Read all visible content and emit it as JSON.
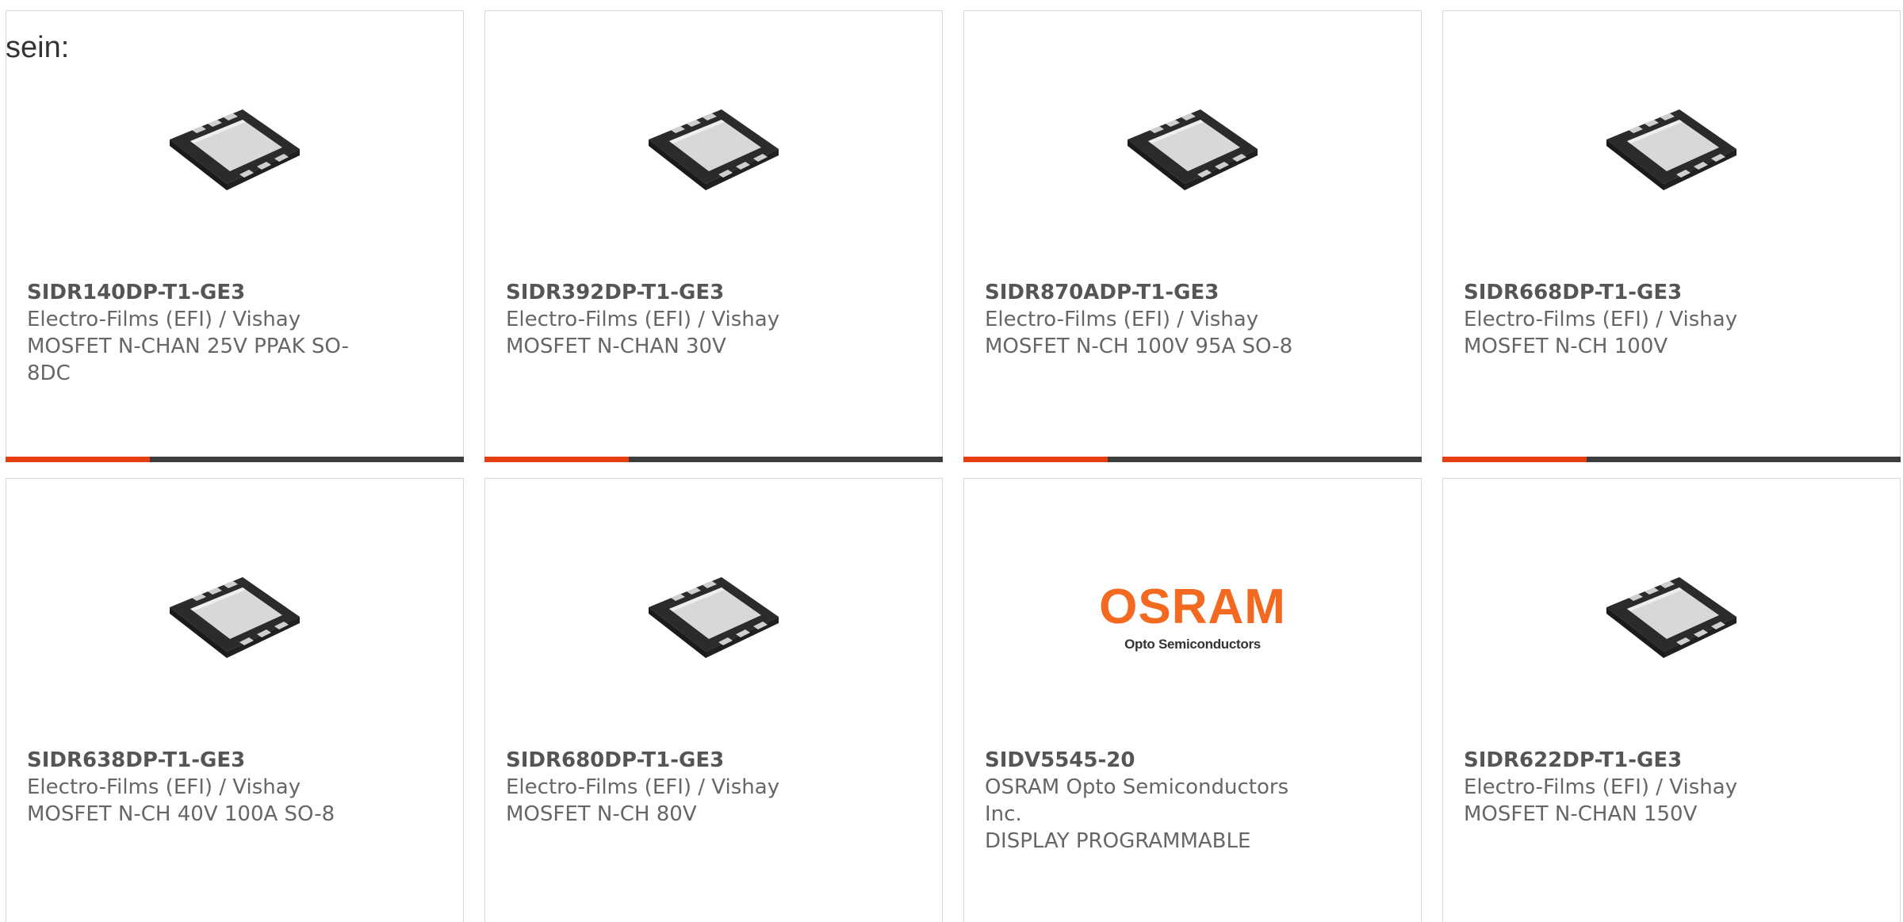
{
  "intro_text": "sein:",
  "colors": {
    "accent": "#e63f12",
    "bar": "#3d3d3d",
    "osram_orange": "#f2691f"
  },
  "products": [
    {
      "part_number": "SIDR140DP-T1-GE3",
      "manufacturer": "Electro-Films (EFI) / Vishay",
      "description": "MOSFET N-CHAN 25V PPAK SO-8DC",
      "image": "mosfet-package-icon"
    },
    {
      "part_number": "SIDR392DP-T1-GE3",
      "manufacturer": "Electro-Films (EFI) / Vishay",
      "description": "MOSFET N-CHAN 30V",
      "image": "mosfet-package-icon"
    },
    {
      "part_number": "SIDR870ADP-T1-GE3",
      "manufacturer": "Electro-Films (EFI) / Vishay",
      "description": "MOSFET N-CH 100V 95A SO-8",
      "image": "mosfet-package-icon"
    },
    {
      "part_number": "SIDR668DP-T1-GE3",
      "manufacturer": "Electro-Films (EFI) / Vishay",
      "description": "MOSFET N-CH 100V",
      "image": "mosfet-package-icon"
    },
    {
      "part_number": "SIDR638DP-T1-GE3",
      "manufacturer": "Electro-Films (EFI) / Vishay",
      "description": "MOSFET N-CH 40V 100A SO-8",
      "image": "mosfet-package-icon"
    },
    {
      "part_number": "SIDR680DP-T1-GE3",
      "manufacturer": "Electro-Films (EFI) / Vishay",
      "description": "MOSFET N-CH 80V",
      "image": "mosfet-package-icon"
    },
    {
      "part_number": "SIDV5545-20",
      "manufacturer": "OSRAM Opto Semiconductors Inc.",
      "description": "DISPLAY PROGRAMMABLE",
      "image": "osram-logo",
      "logo_brand": "OSRAM",
      "logo_sub": "Opto Semiconductors"
    },
    {
      "part_number": "SIDR622DP-T1-GE3",
      "manufacturer": "Electro-Films (EFI) / Vishay",
      "description": "MOSFET N-CHAN 150V",
      "image": "mosfet-package-icon"
    }
  ]
}
